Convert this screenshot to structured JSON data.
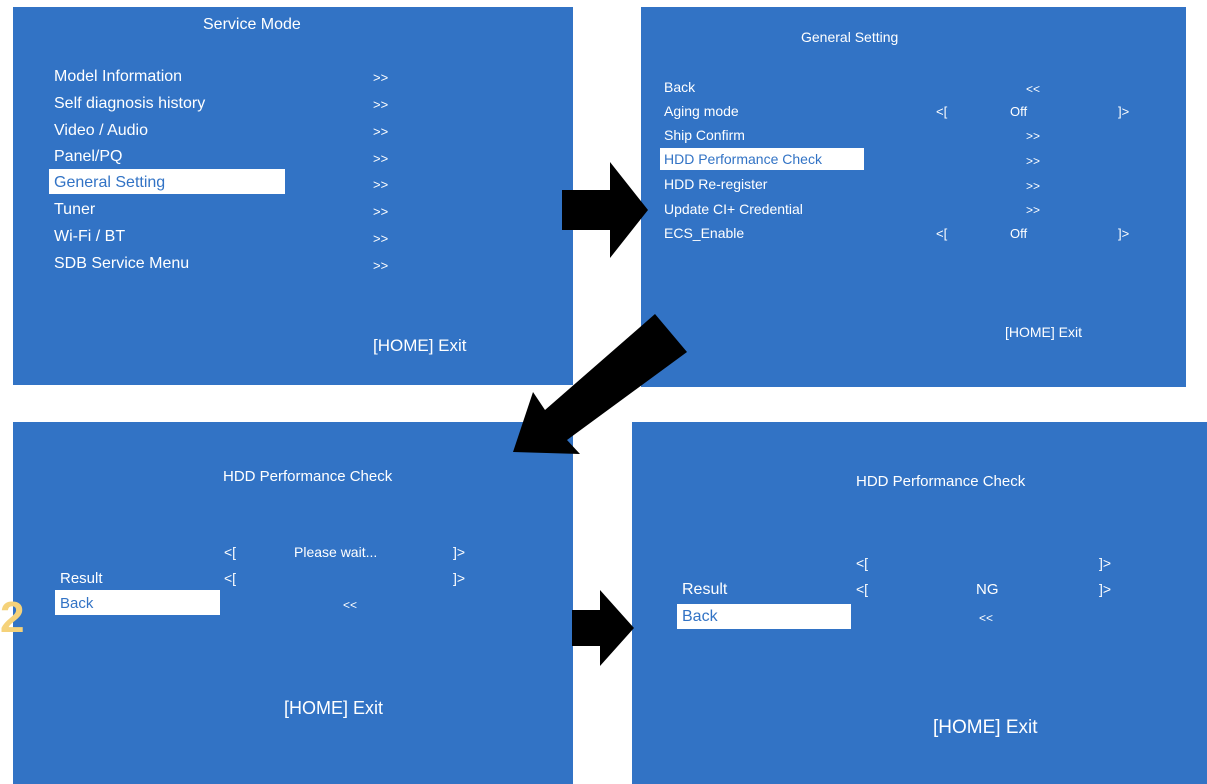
{
  "panels": {
    "service_mode": {
      "title": "Service Mode",
      "items": [
        {
          "label": "Model Information",
          "value": ">>"
        },
        {
          "label": "Self diagnosis history",
          "value": ">>"
        },
        {
          "label": "Video / Audio",
          "value": ">>"
        },
        {
          "label": "Panel/PQ",
          "value": ">>"
        },
        {
          "label": "General Setting",
          "value": ">>"
        },
        {
          "label": "Tuner",
          "value": ">>"
        },
        {
          "label": "Wi-Fi / BT",
          "value": ">>"
        },
        {
          "label": "SDB Service Menu",
          "value": ">>"
        }
      ],
      "selected": "General Setting",
      "exit": "[HOME] Exit"
    },
    "general_setting": {
      "title": "General Setting",
      "items": [
        {
          "label": "Back",
          "value": "<<"
        },
        {
          "label": "Aging mode",
          "left": "<[",
          "value": "Off",
          "right": "]>"
        },
        {
          "label": "Ship Confirm",
          "value": ">>"
        },
        {
          "label": "HDD Performance Check",
          "value": ">>"
        },
        {
          "label": "HDD Re-register",
          "value": ">>"
        },
        {
          "label": "Update CI+ Credential",
          "value": ">>"
        },
        {
          "label": "ECS_Enable",
          "left": "<[",
          "value": "Off",
          "right": "]>"
        }
      ],
      "selected": "HDD Performance Check",
      "exit": "[HOME] Exit"
    },
    "hdd_check_wait": {
      "title": "HDD Performance Check",
      "row1": {
        "left": "<[",
        "value": "Please wait...",
        "right": "]>"
      },
      "result": {
        "label": "Result",
        "left": "<[",
        "value": "",
        "right": "]>"
      },
      "back": {
        "label": "Back",
        "value": "<<"
      },
      "exit": "[HOME] Exit"
    },
    "hdd_check_result": {
      "title": "HDD Performance Check",
      "row1": {
        "left": "<[",
        "value": "",
        "right": "]>"
      },
      "result": {
        "label": "Result",
        "left": "<[",
        "value": "NG",
        "right": "]>"
      },
      "back": {
        "label": "Back",
        "value": "<<"
      },
      "exit": "[HOME] Exit"
    }
  },
  "watermark": "2",
  "colors": {
    "panel_bg": "#3273c5",
    "highlight_bg": "#ffffff",
    "highlight_text": "#3273c5",
    "arrow": "#000000",
    "watermark": "#f5d27a"
  },
  "icons": [
    "arrow-right-icon",
    "arrow-down-left-icon",
    "arrow-right-icon"
  ]
}
